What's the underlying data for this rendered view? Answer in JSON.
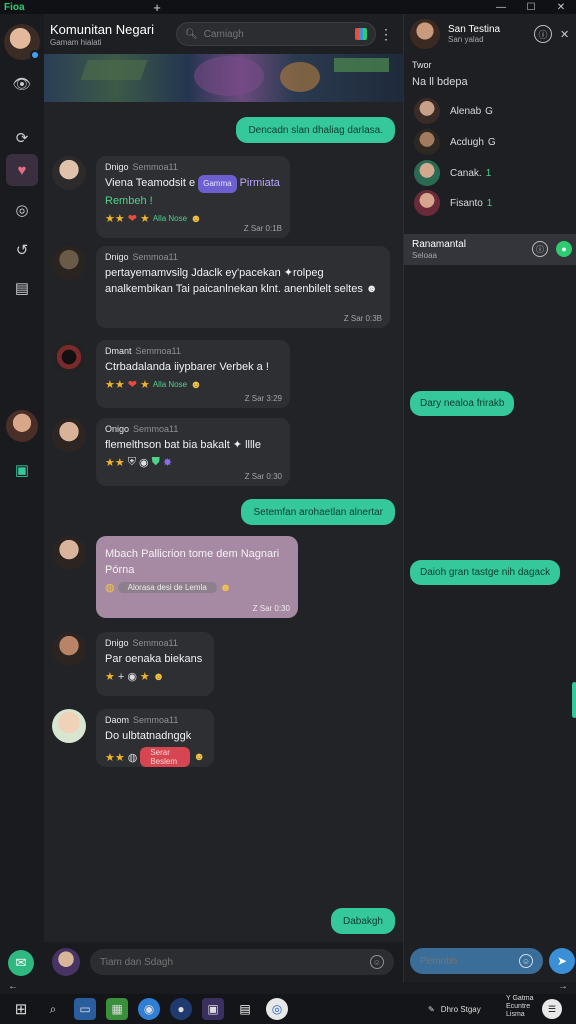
{
  "window": {
    "app_title": "Fioa",
    "new_tab": "+",
    "minimize": "—",
    "maximize": "☐",
    "close": "✕"
  },
  "chat": {
    "title": "Komunitan Negari",
    "subtitle": "Gamam hialati",
    "search_placeholder": "Camiagh",
    "more": "⋮"
  },
  "messages_out": [
    {
      "text": "Dencadn slan dhaliag darlasa."
    },
    {
      "text": "Setemfan arohaetlan alnertar"
    },
    {
      "text": "Dabakgh"
    }
  ],
  "messages_in": [
    {
      "name": "Dnigo",
      "sub": "Semmoa11",
      "text_a": "Viena Teamodsit e",
      "tag": "Gamma",
      "text_b": "Pirmiata",
      "text_c": "Rembeh !",
      "react_text": "Alla Nose",
      "time": "Z Sar 0:1B"
    },
    {
      "name": "Dnigo",
      "sub": "Semmoa11",
      "text": "pertayemamvsilg Jdaclk ey'pacekan ✦rolpeg analkembikan Tai paicanlnekan klnt. anenbilelt seltes ☻",
      "time": "Z Sar 0:3B"
    },
    {
      "name": "Dmant",
      "sub": "Semmoa11",
      "text": "Ctrbadalanda iiypbarer Verbek a !",
      "react_text": "Alla Nose",
      "time": "Z Sar 3:29"
    },
    {
      "name": "Onigo",
      "sub": "Semmoa11",
      "text": "flemelthson bat bia bakalt ✦ lllle",
      "time": "Z Sar 0:30"
    },
    {
      "text": "Mbach Pallicrion tome dem Nagnari Pórna",
      "pill": "Alorasa desi de Lemla",
      "time": "Z Sar 0:30"
    },
    {
      "name": "Dnigo",
      "sub": "Semmoa11",
      "text": "Par oenaka biekans"
    },
    {
      "name": "Daom",
      "sub": "Semmoa11",
      "text": "Do ulbtatnadnggk",
      "pill": "Serar Beslem"
    }
  ],
  "composer": {
    "placeholder": "Tiam dan Sdagh"
  },
  "right_panel": {
    "name": "San Testina",
    "status": "San yalad",
    "section": "Twor",
    "count_label": "Na ll bdepa",
    "members": [
      {
        "name": "Alenab",
        "count": "G"
      },
      {
        "name": "Acdugh",
        "count": "G"
      },
      {
        "name": "Canak.",
        "count": "1"
      },
      {
        "name": "Fisanto",
        "count": "1"
      }
    ],
    "active": {
      "title": "Ranamantal",
      "subtitle": "Seloaa"
    },
    "bubbles": [
      {
        "text": "Dary nealoa frirakb"
      },
      {
        "text": "Daioh gran tastge nih dagack"
      }
    ],
    "composer_placeholder": "Pemnbh"
  },
  "taskbar": {
    "tray_text": "Dhro Stgay",
    "clock": "Y Gatma Ecuntre Lisma"
  },
  "colors": {
    "accent_green": "#35c89b",
    "background": "#1e1f22",
    "bubble_in": "#2e2f33",
    "bubble_pink": "#a68aa3",
    "blue_composer": "#3a6d98"
  }
}
